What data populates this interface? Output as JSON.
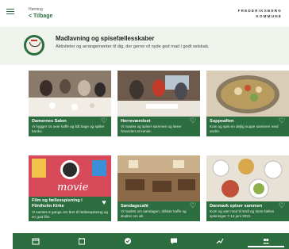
{
  "header": {
    "crumb": "Hørning",
    "back": "< Tilbage",
    "brand_line1": "FREDERIKSBERG",
    "brand_line2": "KOMMUNE"
  },
  "category": {
    "title": "Madlavning og spisefællesskaber",
    "description": "Aktiviteter og arrangementer til dig, der gerne vil nyde god mad i godt selskab.",
    "icon": "cooking-pot-icon"
  },
  "cards": [
    {
      "title": "Damernes Salon",
      "description": "Vi hygger os over kaffe og lidt bage og spiller banko."
    },
    {
      "title": "Herreværelset",
      "description": "Vi mødes og spiser sammen og lærer hinanden at kende."
    },
    {
      "title": "Suppeaften",
      "description": "Kom og spis en dejlig suppe sammen med andre."
    },
    {
      "title": "Film og fællesspisning i Flintholm Kirke",
      "description": "Vi samles 6 gange om året til fællesspisning og en god film."
    },
    {
      "title": "Søndagscafé",
      "description": "Vi mødes om søndagen, drikker kaffe og sludrer om alt."
    },
    {
      "title": "Danmark spiser sammen",
      "description": "Kom og vær med til små og store fælles spisninger 7-13 juni 2021."
    }
  ],
  "nav": [
    {
      "icon": "calendar-grid-icon"
    },
    {
      "icon": "calendar-icon"
    },
    {
      "icon": "check-circle-icon"
    },
    {
      "icon": "chat-icon"
    },
    {
      "icon": "trend-chart-icon"
    },
    {
      "icon": "people-icon"
    }
  ],
  "colors": {
    "brand_green": "#2c6e3f",
    "band_background": "#eef4ec"
  }
}
